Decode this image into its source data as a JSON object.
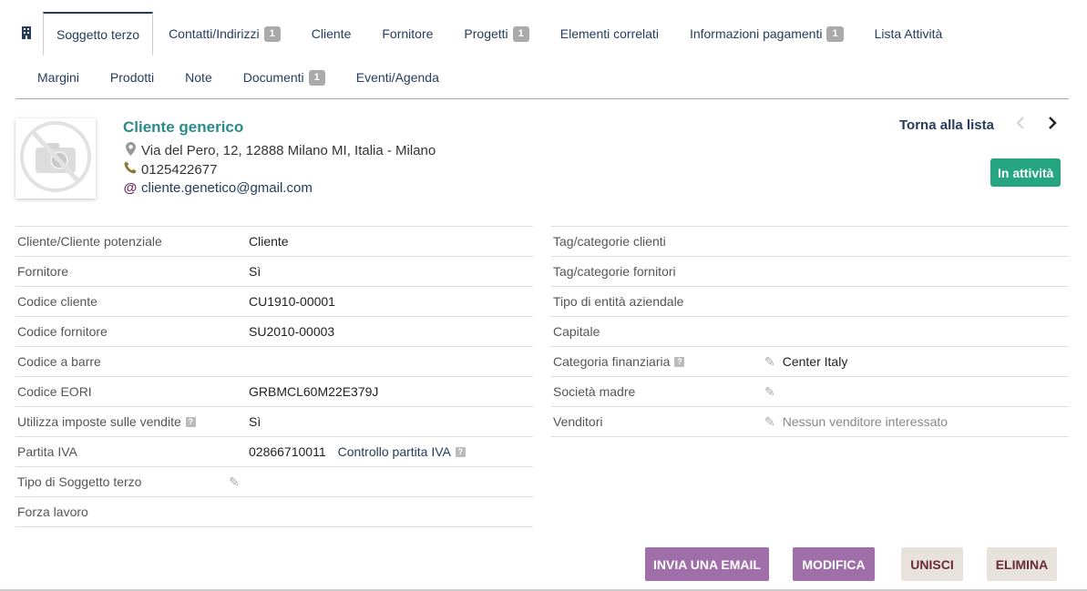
{
  "tabs_row1": [
    {
      "label": "Soggetto terzo",
      "badge": null,
      "active": true
    },
    {
      "label": "Contatti/Indirizzi",
      "badge": "1"
    },
    {
      "label": "Cliente",
      "badge": null
    },
    {
      "label": "Fornitore",
      "badge": null
    },
    {
      "label": "Progetti",
      "badge": "1"
    },
    {
      "label": "Elementi correlati",
      "badge": null
    },
    {
      "label": "Informazioni pagamenti",
      "badge": "1"
    },
    {
      "label": "Lista Attività",
      "badge": null
    }
  ],
  "tabs_row2": [
    {
      "label": "Margini",
      "badge": null
    },
    {
      "label": "Prodotti",
      "badge": null
    },
    {
      "label": "Note",
      "badge": null
    },
    {
      "label": "Documenti",
      "badge": "1"
    },
    {
      "label": "Eventi/Agenda",
      "badge": null
    }
  ],
  "company": {
    "name": "Cliente generico",
    "address": "Via del Pero, 12, 12888 Milano MI, Italia - Milano",
    "phone": "0125422677",
    "email": "cliente.genetico@gmail.com"
  },
  "nav": {
    "back_label": "Torna alla lista",
    "prev": "‹",
    "next": "›"
  },
  "status": "In attività",
  "left_fields": [
    {
      "label": "Cliente/Cliente potenziale",
      "value": "Cliente"
    },
    {
      "label": "Fornitore",
      "value": "Sì"
    },
    {
      "label": "Codice cliente",
      "value": "CU1910-00001"
    },
    {
      "label": "Codice fornitore",
      "value": "SU2010-00003"
    },
    {
      "label": "Codice a barre",
      "value": ""
    },
    {
      "label": "Codice EORI",
      "value": "GRBMCL60M22E379J"
    },
    {
      "label": "Utilizza imposte sulle vendite",
      "value": "Sì",
      "help": true
    },
    {
      "label": "Partita IVA",
      "value": "02866710011",
      "link": "Controllo partita IVA"
    },
    {
      "label": "Tipo di Soggetto terzo",
      "value": "",
      "editable": true
    },
    {
      "label": "Forza lavoro",
      "value": ""
    }
  ],
  "right_fields": [
    {
      "label": "Tag/categorie clienti",
      "value": ""
    },
    {
      "label": "Tag/categorie fornitori",
      "value": ""
    },
    {
      "label": "Tipo di entità aziendale",
      "value": ""
    },
    {
      "label": "Capitale",
      "value": ""
    },
    {
      "label": "Categoria finanziaria",
      "value": "Center Italy",
      "help": true,
      "editable": true
    },
    {
      "label": "Società madre",
      "value": "",
      "editable": true
    },
    {
      "label": "Venditori",
      "value": "Nessun venditore interessato",
      "editable": true,
      "muted": true
    }
  ],
  "buttons": {
    "send_email": "INVIA UNA EMAIL",
    "edit": "MODIFICA",
    "merge": "UNISCI",
    "delete": "ELIMINA"
  },
  "colors": {
    "accent": "#263c5c",
    "name": "#2b8a8a",
    "status": "#25a580",
    "primary_button": "#a06ea8",
    "secondary_button": "#e8e2dc"
  }
}
